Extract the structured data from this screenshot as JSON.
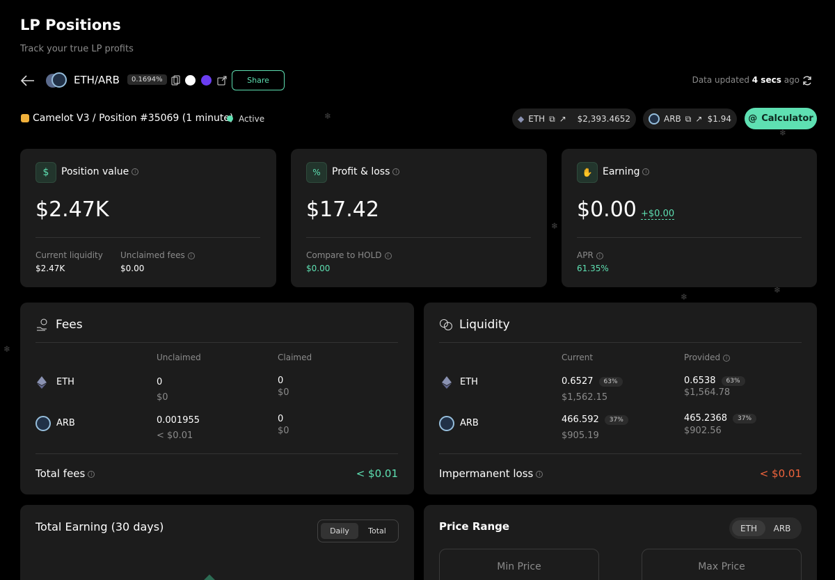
{
  "header": {
    "title": "LP Positions",
    "subtitle": "Track your true LP profits"
  },
  "pair": {
    "name": "ETH/ARB",
    "fee_tier": "0.1694%",
    "share_label": "Share",
    "data_updated_prefix": "Data updated",
    "data_updated_value": "4 secs",
    "data_updated_suffix": "ago"
  },
  "position": {
    "label": "Camelot V3 / Position #35069 (1 minute)",
    "status": "Active"
  },
  "prices": {
    "eth_symbol": "ETH",
    "eth_price": "$2,393.4652",
    "arb_symbol": "ARB",
    "arb_price": "$1.94",
    "calculator_label": "Calculator"
  },
  "cards": {
    "position_value": {
      "title": "Position value",
      "value": "$2.47K",
      "current_liquidity_label": "Current liquidity",
      "current_liquidity_value": "$2.47K",
      "unclaimed_fees_label": "Unclaimed fees",
      "unclaimed_fees_value": "$0.00"
    },
    "profit_loss": {
      "title": "Profit & loss",
      "value": "$17.42",
      "compare_label": "Compare to HOLD",
      "compare_value": "$0.00"
    },
    "earning": {
      "title": "Earning",
      "value": "$0.00",
      "delta": "+$0.00",
      "apr_label": "APR",
      "apr_value": "61.35%"
    }
  },
  "fees": {
    "title": "Fees",
    "col_unclaimed": "Unclaimed",
    "col_claimed": "Claimed",
    "rows": [
      {
        "token": "ETH",
        "unclaimed": "0",
        "unclaimed_usd": "$0",
        "claimed": "0",
        "claimed_usd": "$0"
      },
      {
        "token": "ARB",
        "unclaimed": "0.001955",
        "unclaimed_usd": "< $0.01",
        "claimed": "0",
        "claimed_usd": "$0"
      }
    ],
    "total_label": "Total fees",
    "total_value": "< $0.01"
  },
  "liquidity": {
    "title": "Liquidity",
    "col_current": "Current",
    "col_provided": "Provided",
    "rows": [
      {
        "token": "ETH",
        "current": "0.6527",
        "current_pct": "63%",
        "current_usd": "$1,562.15",
        "provided": "0.6538",
        "provided_pct": "63%",
        "provided_usd": "$1,564.78"
      },
      {
        "token": "ARB",
        "current": "466.592",
        "current_pct": "37%",
        "current_usd": "$905.19",
        "provided": "465.2368",
        "provided_pct": "37%",
        "provided_usd": "$902.56"
      }
    ],
    "il_label": "Impermanent loss",
    "il_value": "< $0.01"
  },
  "earning_chart": {
    "title": "Total Earning (30 days)",
    "tab_daily": "Daily",
    "tab_total": "Total"
  },
  "price_range": {
    "title": "Price Range",
    "toggle_eth": "ETH",
    "toggle_arb": "ARB",
    "min_label": "Min Price",
    "max_label": "Max Price"
  },
  "colors": {
    "accent": "#5ee0b2",
    "negative": "#f0643c"
  }
}
